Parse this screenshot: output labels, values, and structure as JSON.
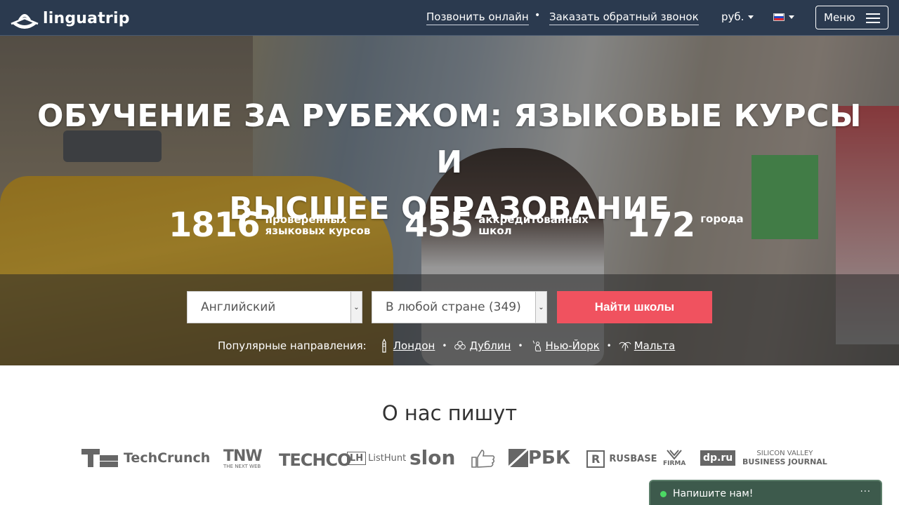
{
  "header": {
    "logo_text": "linguatrip",
    "call_online": "Позвонить онлайн",
    "callback": "Заказать обратный звонок",
    "currency": "руб.",
    "language_flag": "ru-flag-icon",
    "menu_label": "Меню"
  },
  "hero": {
    "title_line1": "ОБУЧЕНИЕ ЗА РУБЕЖОМ: ЯЗЫКОВЫЕ КУРСЫ И",
    "title_line2": "ВЫСШЕЕ ОБРАЗОВАНИЕ",
    "stats": [
      {
        "number": "1816",
        "label_1": "проверенных",
        "label_2": "языковых курсов"
      },
      {
        "number": "455",
        "label_1": "аккредитованных",
        "label_2": "школ"
      },
      {
        "number": "172",
        "label_1": "города",
        "label_2": ""
      }
    ]
  },
  "search": {
    "language_select": "Английский",
    "country_select": "В любой стране (349)",
    "button": "Найти школы",
    "popular_label": "Популярные направления:",
    "popular": [
      {
        "name": "Лондон",
        "icon": "big-ben-icon"
      },
      {
        "name": "Дублин",
        "icon": "clover-icon"
      },
      {
        "name": "Нью-Йорк",
        "icon": "statue-of-liberty-icon"
      },
      {
        "name": "Мальта",
        "icon": "palm-icon"
      }
    ]
  },
  "press": {
    "title": "О нас пишут",
    "logos": [
      "TechCrunch",
      "TNW",
      "THE NEXT WEB",
      "TECHCO",
      "ListHunt",
      "slon",
      "РБК",
      "RUSBASE",
      "FIRMA",
      "dp.ru",
      "SILICON VALLEY",
      "BUSINESS JOURNAL"
    ]
  },
  "chat": {
    "label": "Напишите нам!",
    "more": "···"
  },
  "colors": {
    "header_bg": "#2b3a4f",
    "search_button": "#f0525f",
    "chat_bg": "#3d5a4c",
    "chat_status": "#4cd964"
  }
}
